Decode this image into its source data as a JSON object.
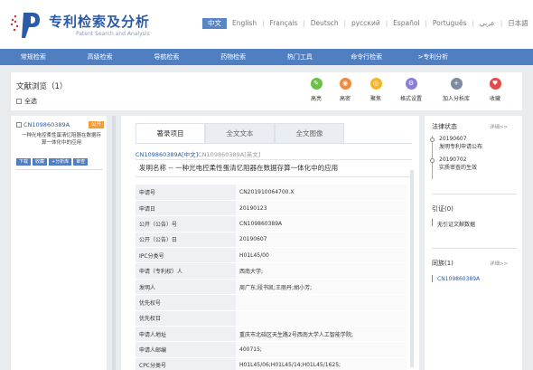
{
  "header": {
    "title": "专利检索及分析",
    "subtitle": "Patent Search and Analysis",
    "languages": [
      "中文",
      "English",
      "Français",
      "Deutsch",
      "русский",
      "Español",
      "Português",
      "عربي",
      "日本語"
    ]
  },
  "nav": {
    "items": [
      "常规检索",
      "高级检索",
      "导航检索",
      "药物检索",
      "热门工具",
      "命令行检索",
      ">专利分析"
    ]
  },
  "toolbar": {
    "title": "文献浏览（1）",
    "select_all": "全选",
    "tools": [
      {
        "label": "高亮",
        "color": "#6cc04a",
        "icon": "highlight-icon",
        "glyph": "✎"
      },
      {
        "label": "高密",
        "color": "#f08a3c",
        "icon": "density-icon",
        "glyph": "◉"
      },
      {
        "label": "聚焦",
        "color": "#f3b62b",
        "icon": "focus-icon",
        "glyph": "◎"
      },
      {
        "label": "格式设置",
        "color": "#8a7fd8",
        "icon": "format-icon",
        "glyph": "⚙"
      },
      {
        "label": "加入分析库",
        "color": "#7d8aa0",
        "icon": "add-icon",
        "glyph": "+"
      },
      {
        "label": "收藏",
        "color": "#e54a4a",
        "icon": "favorite-icon",
        "glyph": "♥"
      }
    ]
  },
  "list": {
    "item": {
      "number": "CN109860389A",
      "badge": "公开",
      "title": "一种光电控柔性蛋清忆阻器在数据存算一体化中的应用",
      "actions": [
        "下载",
        "收藏",
        "+分析库",
        "审查"
      ]
    }
  },
  "main": {
    "tabs": [
      "著录项目",
      "全文文本",
      "全文图像"
    ],
    "doc_number": "CN109860389A[中文]",
    "doc_number_en": "CN109860389A[英文]",
    "invention_label": "发明名称 --",
    "invention_name": "一种光电控柔性蛋清忆阻器在数据存算一体化中的应用",
    "fields": [
      {
        "key": "申请号",
        "value": "CN201910064700.X"
      },
      {
        "key": "申请日",
        "value": "20190123"
      },
      {
        "key": "公开（公告）号",
        "value": "CN109860389A"
      },
      {
        "key": "公开（公告）日",
        "value": "20190607"
      },
      {
        "key": "IPC分类号",
        "value": "H01L45/00"
      },
      {
        "key": "申请（专利权）人",
        "value": "西南大学;"
      },
      {
        "key": "发明人",
        "value": "周广东;段书凯;王丽丹;胡小芳;"
      },
      {
        "key": "优先权号",
        "value": ""
      },
      {
        "key": "优先权日",
        "value": ""
      },
      {
        "key": "申请人地址",
        "value": "重庆市北碚区天生路2号西南大学人工智能学院;"
      },
      {
        "key": "申请人邮编",
        "value": "400715;"
      },
      {
        "key": "CPC分类号",
        "value": "H01L45/06;H01L45/14;H01L45/1625;"
      }
    ]
  },
  "right": {
    "legal_status_title": "法律状态",
    "more": "详细>>",
    "timeline": [
      {
        "date": "20190607",
        "text": "发明专利申请公布"
      },
      {
        "date": "20190702",
        "text": "实质审查的生效"
      }
    ],
    "citation_title": "引证(0)",
    "citation_empty": "无引证文献数据",
    "family_title": "同族(1)",
    "family_more": "详细>>",
    "family_item": "CN109860389A"
  }
}
